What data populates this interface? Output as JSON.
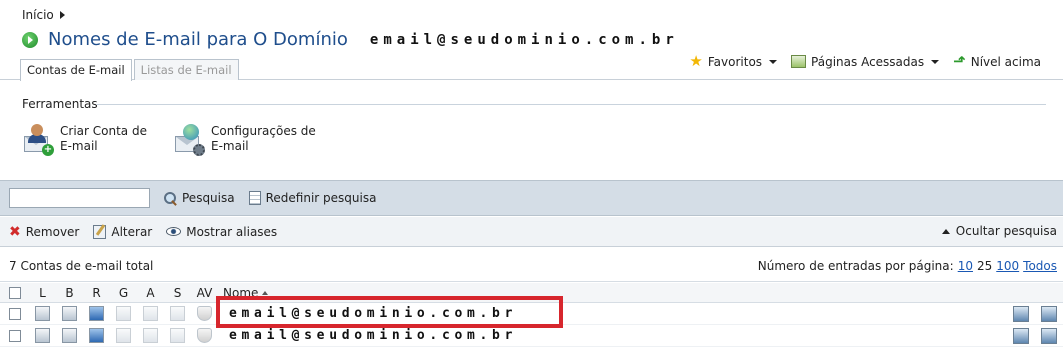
{
  "breadcrumb": {
    "home": "Início"
  },
  "header": {
    "title": "Nomes de E-mail para O Domínio",
    "domain": "email@seudominio.com.br",
    "tabs": [
      {
        "label": "Contas de E-mail",
        "active": true
      },
      {
        "label": "Listas de E-mail",
        "active": false
      }
    ],
    "links": {
      "favorites": "Favoritos",
      "visited": "Páginas Acessadas",
      "level_up": "Nível acima"
    }
  },
  "tools": {
    "heading": "Ferramentas",
    "create": "Criar Conta de\nE-mail",
    "settings": "Configurações de\nE-mail"
  },
  "search": {
    "value": "",
    "search_button": "Pesquisa",
    "reset_button": "Redefinir pesquisa"
  },
  "actions": {
    "remove": "Remover",
    "edit": "Alterar",
    "show_aliases": "Mostrar aliases",
    "hide_search": "Ocultar pesquisa"
  },
  "summary": {
    "total": "7 Contas de e-mail total",
    "per_page_label": "Número de entradas por página:",
    "options": [
      "10",
      "25",
      "100",
      "Todos"
    ],
    "current": "25"
  },
  "table": {
    "columns": [
      "L",
      "B",
      "R",
      "G",
      "A",
      "S",
      "AV",
      "Nome"
    ],
    "rows": [
      {
        "email": "email@seudominio.com.br"
      },
      {
        "email": "email@seudominio.com.br"
      }
    ]
  },
  "colors": {
    "title_blue": "#1f4e8c",
    "highlight_red": "#d7262d",
    "link_blue": "#1a58b3",
    "bar_bg": "#d4dde6"
  }
}
